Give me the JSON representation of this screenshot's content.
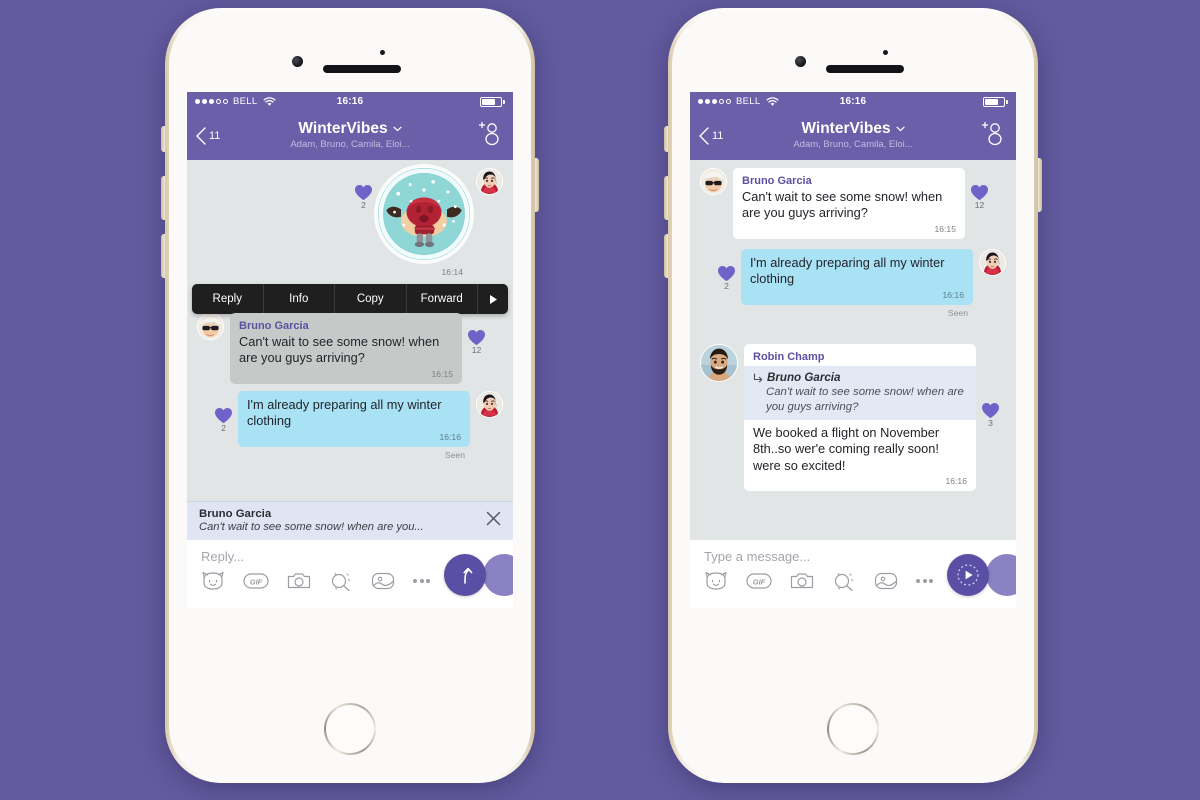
{
  "background_color": "#625b9e",
  "theme": {
    "header_purple": "#6a5fa8",
    "chat_bg": "#e2e5e5",
    "out_bubble": "#a9e1f5",
    "in_bubble_grey": "#c7c9c9",
    "in_bubble_white": "#ffffff",
    "accent_purple": "#5a4fa5",
    "heart_purple": "#6f63c9",
    "sender_name": "#5c51a0",
    "context_menu_bg": "#1f1f1f"
  },
  "status_bar": {
    "signal_dots_filled": 3,
    "signal_dots_total": 5,
    "carrier": "BELL",
    "wifi_icon": "wifi-icon",
    "time": "16:16",
    "battery_icon": "battery-icon",
    "battery_percent": 72
  },
  "header": {
    "back_icon": "chevron-left-icon",
    "back_count": "11",
    "title": "WinterVibes",
    "title_chevron_icon": "chevron-down-icon",
    "subtitle": "Adam, Bruno, Camila, Eloi...",
    "add_participant_icon": "add-user-icon"
  },
  "phone_1": {
    "sticker_message": {
      "sticker_icon": "snow-globe-pug-sticker",
      "reaction_icon": "heart-icon",
      "reaction_count": "2",
      "time": "16:14",
      "avatar_icon": "avatar-woman-red-scarf"
    },
    "context_menu": {
      "items": [
        "Reply",
        "Info",
        "Copy",
        "Forward"
      ],
      "more_icon": "triangle-right-icon"
    },
    "messages": [
      {
        "direction": "in",
        "avatar_icon": "avatar-man-sunglasses",
        "sender": "Bruno Garcia",
        "text": "Can't wait to see some snow! when are you guys arriving?",
        "time": "16:15",
        "reaction_icon": "heart-icon",
        "reaction_count": "12"
      },
      {
        "direction": "out",
        "avatar_icon": "avatar-woman-red-scarf",
        "text": "I'm already preparing all my winter clothing",
        "time": "16:16",
        "reaction_icon": "heart-icon",
        "reaction_count": "2",
        "status": "Seen"
      }
    ],
    "reply_banner": {
      "name": "Bruno Garcia",
      "preview": "Can't wait to see some snow! when are you...",
      "close_icon": "close-icon"
    },
    "composer": {
      "placeholder": "Reply...",
      "tools": [
        "sticker-cat-icon",
        "gif-icon",
        "camera-icon",
        "doodle-icon",
        "image-icon",
        "more-icon"
      ],
      "send_icon": "send-arrow-icon"
    }
  },
  "phone_2": {
    "messages": [
      {
        "direction": "in",
        "avatar_icon": "avatar-man-sunglasses",
        "sender": "Bruno Garcia",
        "text": "Can't wait to see some snow! when are you guys arriving?",
        "time": "16:15",
        "reaction_icon": "heart-icon",
        "reaction_count": "12"
      },
      {
        "direction": "out",
        "avatar_icon": "avatar-woman-red-scarf",
        "text": "I'm already preparing all my winter clothing",
        "time": "16:16",
        "reaction_icon": "heart-icon",
        "reaction_count": "2",
        "status": "Seen"
      },
      {
        "direction": "in",
        "avatar_icon": "avatar-man-beard",
        "sender": "Robin Champ",
        "quote_icon": "reply-arrow-icon",
        "quote_name": "Bruno Garcia",
        "quote_text": "Can't wait to see some snow! when are you guys arriving?",
        "text": "We booked a flight on November 8th..so wer'e coming really soon! were so excited!",
        "time": "16:16",
        "reaction_icon": "heart-icon",
        "reaction_count": "3"
      }
    ],
    "composer": {
      "placeholder": "Type a message...",
      "tools": [
        "sticker-cat-icon",
        "gif-icon",
        "camera-icon",
        "doodle-icon",
        "image-icon",
        "more-icon"
      ],
      "send_icon": "record-play-icon"
    }
  },
  "hardware": {
    "camera_icon": "front-camera",
    "sensor_icon": "proximity-sensor",
    "speaker_icon": "earpiece-speaker",
    "home_button_icon": "home-button"
  }
}
